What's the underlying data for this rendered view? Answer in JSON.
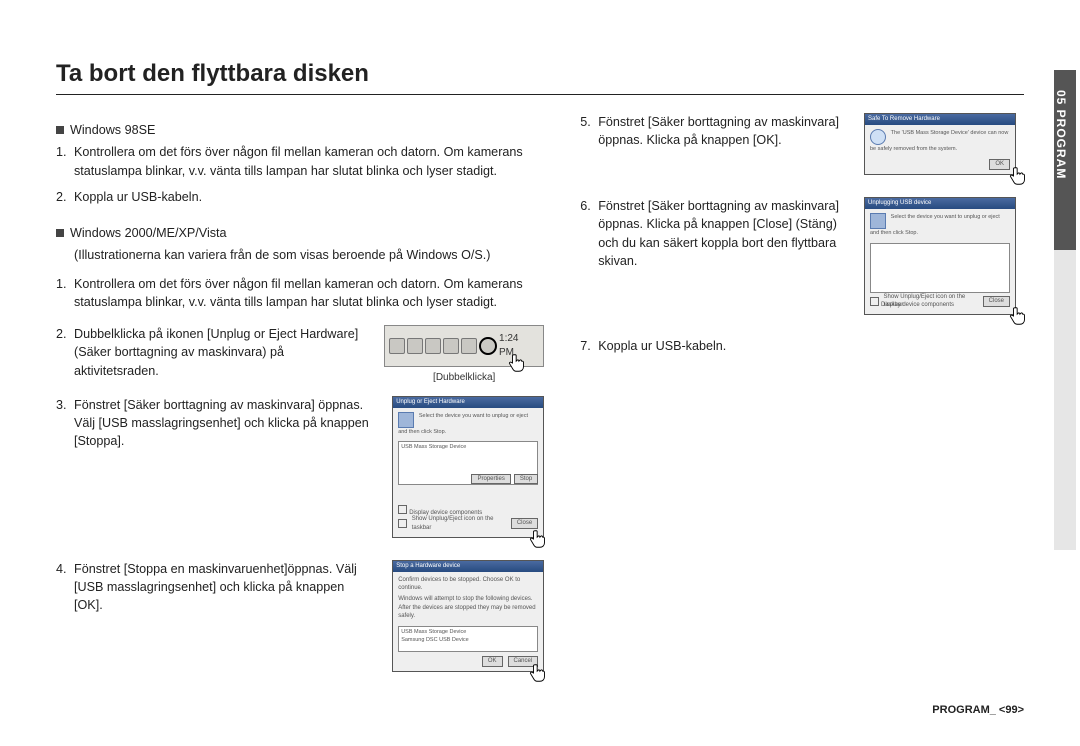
{
  "title": "Ta bort den flyttbara disken",
  "section1": {
    "heading": "Windows 98SE",
    "step1_num": "1.",
    "step1": "Kontrollera om det förs över någon fil mellan kameran och datorn. Om kamerans statuslampa blinkar, v.v. vänta tills lampan har slutat blinka och lyser stadigt.",
    "step2_num": "2.",
    "step2": "Koppla ur USB-kabeln."
  },
  "section2": {
    "heading": "Windows 2000/ME/XP/Vista",
    "note": "(Illustrationerna kan variera från de som visas beroende på Windows O/S.)",
    "step1_num": "1.",
    "step1": "Kontrollera om det förs över någon fil mellan kameran och datorn. Om kamerans statuslampa blinkar, v.v. vänta tills lampan har slutat blinka och lyser stadigt.",
    "step2_num": "2.",
    "step2": "Dubbelklicka på ikonen [Unplug or Eject Hardware](Säker borttagning av maskinvara) på aktivitetsraden.",
    "step3_num": "3.",
    "step3": "Fönstret [Säker borttagning av maskinvara] öppnas. Välj [USB masslagringsenhet] och klicka på knappen [Stoppa].",
    "step4_num": "4.",
    "step4": "Fönstret [Stoppa en maskinvaruenhet]öppnas. Välj [USB masslagringsenhet] och klicka på knappen [OK]."
  },
  "section3": {
    "step5_num": "5.",
    "step5": "Fönstret [Säker borttagning av maskinvara] öppnas. Klicka på knappen [OK].",
    "step6_num": "6.",
    "step6": "Fönstret [Säker borttagning av maskinvara] öppnas. Klicka på knappen [Close] (Stäng) och du kan säkert koppla bort den flyttbara skivan.",
    "step7_num": "7.",
    "step7": "Koppla ur USB-kabeln."
  },
  "tray": {
    "time": "1:24 PM",
    "caption": "[Dubbelklicka]"
  },
  "dlg3": {
    "title": "Unplug or Eject Hardware",
    "item": "USB Mass Storage Device",
    "btn1": "Properties",
    "btn2": "Stop",
    "chk": "Display device components",
    "chk2": "Show Unplug/Eject icon on the taskbar",
    "close": "Close"
  },
  "dlg4": {
    "title": "Stop a Hardware device",
    "line1": "Confirm devices to be stopped. Choose OK to continue.",
    "line2": "Windows will attempt to stop the following devices. After the devices are stopped they may be removed safely.",
    "item1": "USB Mass Storage Device",
    "item2": "Samsung DSC USB Device",
    "ok": "OK",
    "cancel": "Cancel"
  },
  "dlg5": {
    "title": "Safe To Remove Hardware",
    "msg": "The 'USB Mass Storage Device' device can now be safely removed from the system.",
    "ok": "OK"
  },
  "dlg6": {
    "title": "Unplugging USB device",
    "list_title": "Select the device you want to unplug or eject and then click Stop.",
    "chk": "Display device components",
    "chk2": "Show Unplug/Eject icon on the taskbar",
    "close": "Close"
  },
  "sidetab": "05 PROGRAM",
  "footer": "PROGRAM_ <99>"
}
